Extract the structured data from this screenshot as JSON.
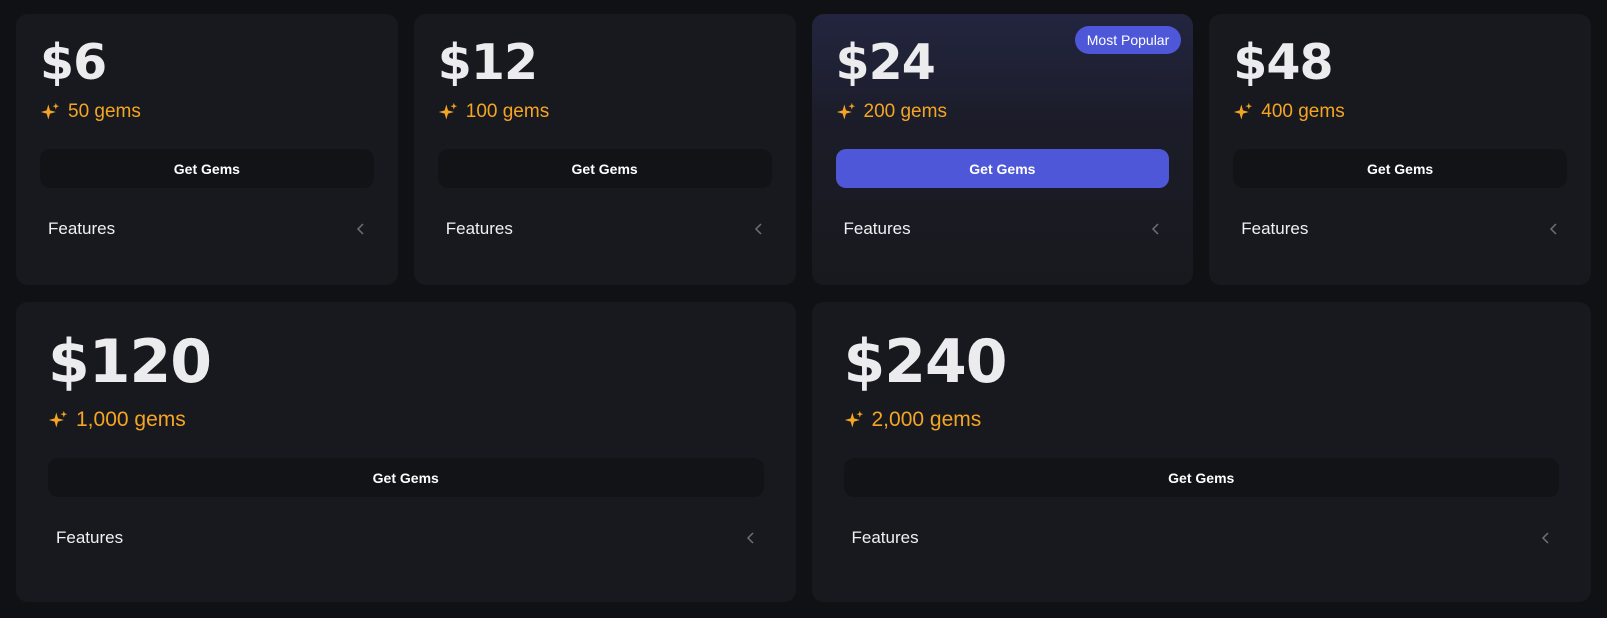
{
  "plans_top": [
    {
      "price": "$6",
      "gems": "50 gems",
      "button": "Get Gems",
      "features": "Features"
    },
    {
      "price": "$12",
      "gems": "100 gems",
      "button": "Get Gems",
      "features": "Features"
    },
    {
      "price": "$24",
      "gems": "200 gems",
      "button": "Get Gems",
      "features": "Features",
      "badge": "Most Popular"
    },
    {
      "price": "$48",
      "gems": "400 gems",
      "button": "Get Gems",
      "features": "Features"
    }
  ],
  "plans_bottom": [
    {
      "price": "$120",
      "gems": "1,000 gems",
      "button": "Get Gems",
      "features": "Features"
    },
    {
      "price": "$240",
      "gems": "2,000 gems",
      "button": "Get Gems",
      "features": "Features"
    }
  ],
  "icons": {
    "gem": "sparkle-icon",
    "features_toggle": "chevron-left-icon"
  },
  "colors": {
    "background": "#101114",
    "card": "#18191e",
    "accent": "#4e57d8",
    "gems_text": "#f5a524",
    "button_dark": "#121316"
  }
}
